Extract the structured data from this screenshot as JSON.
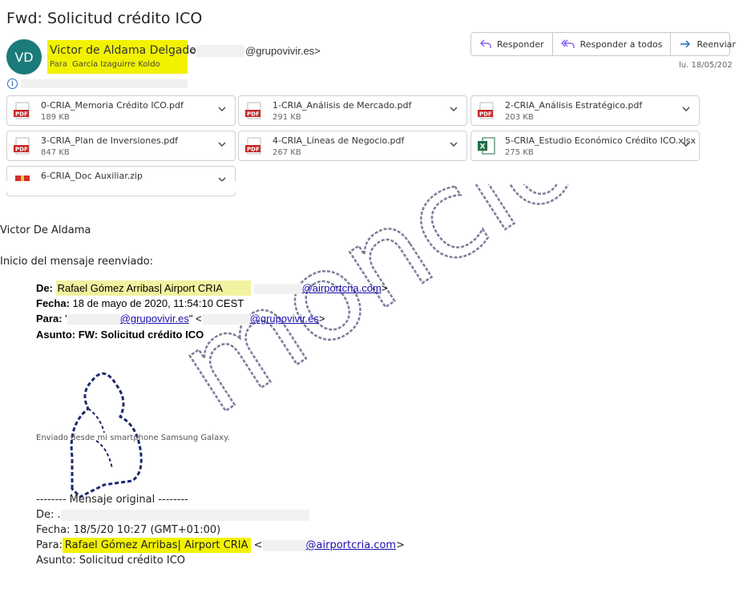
{
  "email": {
    "subject": "Fwd: Solicitud crédito ICO",
    "avatar_initials": "VD",
    "sender_name": "Victor de Aldama Delgado",
    "sender_email_prefix": "<",
    "sender_email_domain": "@grupovivir.es>",
    "to_label": "Para",
    "to_value": "García Izaguirre Koldo",
    "date": "lu. 18/05/202",
    "actions": [
      {
        "label": "Responder",
        "icon": "reply-icon"
      },
      {
        "label": "Responder a todos",
        "icon": "reply-all-icon"
      },
      {
        "label": "Reenviar",
        "icon": "forward-icon"
      }
    ]
  },
  "attachments": [
    {
      "name": "0-CRIA_Memoria Crédito ICO.pdf",
      "size": "189 KB",
      "type": "pdf"
    },
    {
      "name": "1-CRIA_Análisis de Mercado.pdf",
      "size": "291 KB",
      "type": "pdf"
    },
    {
      "name": "2-CRIA_Análisis Estratégico.pdf",
      "size": "203 KB",
      "type": "pdf"
    },
    {
      "name": "3-CRIA_Plan de Inversiones.pdf",
      "size": "847 KB",
      "type": "pdf"
    },
    {
      "name": "4-CRIA_Líneas de Negocio.pdf",
      "size": "267 KB",
      "type": "pdf"
    },
    {
      "name": "5-CRIA_Estudio Económico Crédito ICO.xlsx",
      "size": "275 KB",
      "type": "xlsx"
    },
    {
      "name": "6-CRIA_Doc Auxiliar.zip",
      "size": "",
      "type": "zip"
    }
  ],
  "body": {
    "greeting": "Victor De Aldama",
    "forwarded_intro": "Inicio del mensaje reenviado:",
    "fwd_header": {
      "de_label": "De:",
      "de_name": "Rafael Gómez Arribas| Airport CRIA",
      "de_email": "@airportcria.com",
      "fecha_label": "Fecha:",
      "fecha_value": "18 de mayo de 2020, 11:54:10 CEST",
      "para_label": "Para:",
      "para_q1": "'",
      "para_email1": "@grupovivir.es",
      "para_q2": "\" <",
      "para_email2": "@grupovivir.es",
      "asunto_label": "Asunto:",
      "asunto_value": "FW:  Solicitud crédito ICO"
    },
    "sent_from": "Enviado desde mi smartphone Samsung Galaxy.",
    "original_sep": "-------- Mensaje original --------",
    "orig": {
      "de_label": "De:",
      "de_value": ".",
      "fecha": "Fecha: 18/5/20 10:27 (GMT+01:00)",
      "para_label": "Para:",
      "para_name": "Rafael Gómez Arribas| Airport CRIA",
      "para_lt": " <",
      "para_email": "@airportcria.com",
      "asunto": "Asunto: Solicitud crédito ICO"
    }
  },
  "watermark": "moncloa"
}
